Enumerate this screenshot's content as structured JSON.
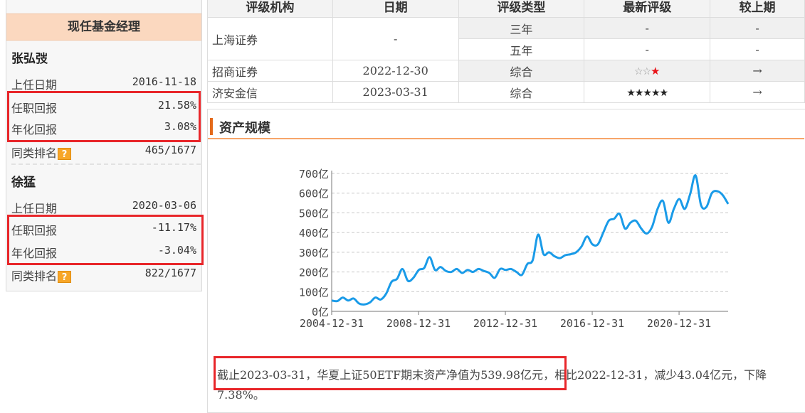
{
  "managers_panel": {
    "title": "现任基金经理",
    "managers": [
      {
        "name": "张弘弢",
        "start_label": "上任日期",
        "start_date": "2016-11-18",
        "return_label": "任职回报",
        "return": "21.58%",
        "annual_label": "年化回报",
        "annual": "3.08%",
        "rank_label": "同类排名",
        "rank": "465/1677"
      },
      {
        "name": "徐猛",
        "start_label": "上任日期",
        "start_date": "2020-03-06",
        "return_label": "任职回报",
        "return": "-11.17%",
        "annual_label": "年化回报",
        "annual": "-3.04%",
        "rank_label": "同类排名",
        "rank": "822/1677"
      }
    ],
    "help_icon": "question-mark-icon",
    "help_glyph": "?"
  },
  "ratings_table": {
    "headers": [
      "评级机构",
      "日期",
      "评级类型",
      "最新评级",
      "较上期"
    ],
    "rows": [
      {
        "org": "上海证券",
        "date": "-",
        "type": "三年",
        "rating": "-",
        "change": "-"
      },
      {
        "org": "",
        "date": "",
        "type": "五年",
        "rating": "-",
        "change": "-"
      },
      {
        "org": "招商证券",
        "date": "2022-12-30",
        "type": "综合",
        "rating_hollow": "☆☆",
        "rating_red": "★",
        "change": "→"
      },
      {
        "org": "济安金信",
        "date": "2023-03-31",
        "type": "综合",
        "rating_solid": "★★★★★",
        "change": "→"
      }
    ]
  },
  "asset_section": {
    "title": "资产规模",
    "summary_prefix": "截止2023-03-31，华夏上证50ETF期末资产净值为539.98亿元",
    "summary_suffix": "，相比2022-12-31，减少43.04亿元，下降7.38%。"
  },
  "colors": {
    "line": "#1a9be8",
    "highlight": "#e8262a",
    "header_bg": "#fbd8bf",
    "accent": "#e46a1b"
  },
  "chart_data": {
    "type": "line",
    "title": "",
    "xlabel": "",
    "ylabel": "",
    "x_ticks": [
      "2004-12-31",
      "2008-12-31",
      "2012-12-31",
      "2016-12-31",
      "2020-12-31"
    ],
    "y_ticks": [
      "0亿",
      "100亿",
      "200亿",
      "300亿",
      "400亿",
      "500亿",
      "600亿",
      "700亿"
    ],
    "ylim": [
      0,
      700
    ],
    "xlim": [
      2004.99,
      2023.25
    ],
    "grid": "horizontal-dashed",
    "series": [
      {
        "name": "",
        "x": [
          2004.99,
          2005.25,
          2005.5,
          2005.75,
          2006.0,
          2006.25,
          2006.5,
          2006.75,
          2007.0,
          2007.25,
          2007.5,
          2007.75,
          2008.0,
          2008.25,
          2008.5,
          2008.75,
          2009.0,
          2009.25,
          2009.5,
          2009.75,
          2010.0,
          2010.25,
          2010.5,
          2010.75,
          2011.0,
          2011.25,
          2011.5,
          2011.75,
          2012.0,
          2012.25,
          2012.5,
          2012.75,
          2013.0,
          2013.25,
          2013.5,
          2013.75,
          2014.0,
          2014.25,
          2014.5,
          2014.75,
          2015.0,
          2015.25,
          2015.5,
          2015.75,
          2016.0,
          2016.25,
          2016.5,
          2016.75,
          2017.0,
          2017.25,
          2017.5,
          2017.75,
          2018.0,
          2018.25,
          2018.5,
          2018.75,
          2019.0,
          2019.25,
          2019.5,
          2019.75,
          2020.0,
          2020.25,
          2020.5,
          2020.75,
          2021.0,
          2021.25,
          2021.5,
          2021.75,
          2022.0,
          2022.25,
          2022.5,
          2022.75,
          2023.0,
          2023.25
        ],
        "values": [
          55,
          52,
          70,
          55,
          65,
          40,
          35,
          45,
          70,
          60,
          90,
          150,
          165,
          215,
          155,
          170,
          210,
          220,
          275,
          210,
          225,
          205,
          200,
          215,
          195,
          210,
          200,
          215,
          205,
          195,
          170,
          215,
          210,
          215,
          200,
          185,
          240,
          260,
          390,
          290,
          300,
          280,
          270,
          285,
          290,
          300,
          330,
          380,
          340,
          340,
          400,
          460,
          470,
          495,
          420,
          450,
          460,
          420,
          395,
          430,
          520,
          560,
          450,
          520,
          570,
          520,
          595,
          690,
          540,
          530,
          600,
          610,
          590,
          545
        ]
      }
    ]
  }
}
